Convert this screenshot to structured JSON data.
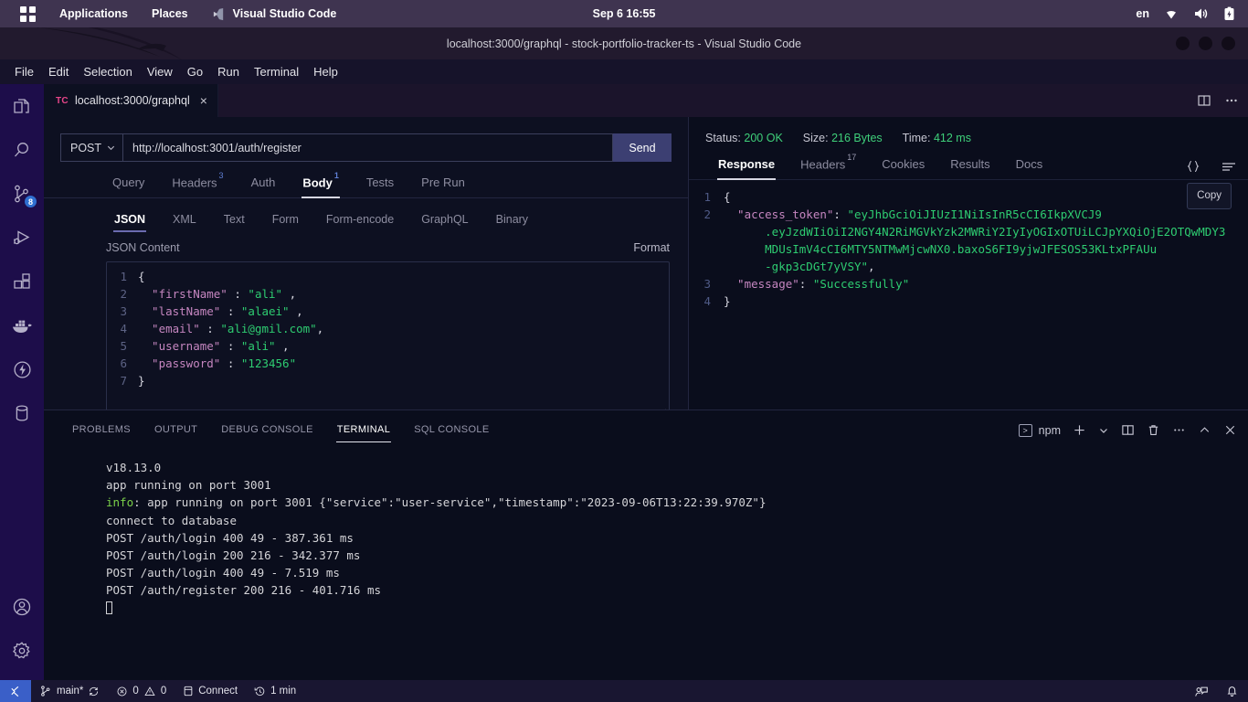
{
  "os_panel": {
    "apps_label": "Applications",
    "places_label": "Places",
    "active_app": "Visual Studio Code",
    "clock": "Sep 6  16:55",
    "language": "en",
    "icons": [
      "wifi-icon",
      "volume-icon",
      "battery-icon"
    ]
  },
  "titlebar": {
    "title": "localhost:3000/graphql - stock-portfolio-tracker-ts - Visual Studio Code",
    "window_controls": [
      "minimize-button",
      "maximize-button",
      "close-button"
    ]
  },
  "menubar": {
    "items": [
      "File",
      "Edit",
      "Selection",
      "View",
      "Go",
      "Run",
      "Terminal",
      "Help"
    ]
  },
  "activitybar": {
    "items": [
      {
        "name": "explorer",
        "icon": "files-icon",
        "badge": ""
      },
      {
        "name": "search",
        "icon": "search-icon",
        "badge": ""
      },
      {
        "name": "source-control",
        "icon": "source-control-icon",
        "badge": "8"
      },
      {
        "name": "run-and-debug",
        "icon": "run-debug-icon",
        "badge": ""
      },
      {
        "name": "extensions",
        "icon": "extensions-icon",
        "badge": ""
      },
      {
        "name": "docker",
        "icon": "docker-whale-icon",
        "badge": ""
      },
      {
        "name": "thunder-client",
        "icon": "thunderbolt-icon",
        "badge": ""
      },
      {
        "name": "database",
        "icon": "database-icon",
        "badge": ""
      }
    ],
    "bottom": [
      {
        "name": "accounts",
        "icon": "account-icon"
      },
      {
        "name": "settings",
        "icon": "gear-icon"
      }
    ]
  },
  "editor": {
    "tab": {
      "badge": "TC",
      "label": "localhost:3000/graphql",
      "close": "×"
    },
    "actions": [
      "split-editor-icon",
      "more-actions-icon"
    ]
  },
  "request": {
    "method": "POST",
    "method_caret": "chevron-down-icon",
    "url": "http://localhost:3001/auth/register",
    "send_label": "Send",
    "tabs": [
      {
        "label": "Query",
        "badge": "",
        "active": false
      },
      {
        "label": "Headers",
        "badge": "3",
        "active": false
      },
      {
        "label": "Auth",
        "badge": "",
        "active": false
      },
      {
        "label": "Body",
        "badge": "1",
        "active": true
      },
      {
        "label": "Tests",
        "badge": "",
        "active": false
      },
      {
        "label": "Pre Run",
        "badge": "",
        "active": false
      }
    ],
    "body_types": [
      {
        "label": "JSON",
        "active": true
      },
      {
        "label": "XML",
        "active": false
      },
      {
        "label": "Text",
        "active": false
      },
      {
        "label": "Form",
        "active": false
      },
      {
        "label": "Form-encode",
        "active": false
      },
      {
        "label": "GraphQL",
        "active": false
      },
      {
        "label": "Binary",
        "active": false
      }
    ],
    "json_content_label": "JSON Content",
    "format_label": "Format",
    "body_lines": [
      {
        "n": "1",
        "segments": [
          {
            "t": "{",
            "c": "k-punc"
          }
        ]
      },
      {
        "n": "2",
        "segments": [
          {
            "t": "  \"firstName\"",
            "c": "k-key"
          },
          {
            "t": " : ",
            "c": "k-colon"
          },
          {
            "t": "\"ali\"",
            "c": "k-str"
          },
          {
            "t": " ,",
            "c": "k-punc"
          }
        ]
      },
      {
        "n": "3",
        "segments": [
          {
            "t": "  \"lastName\"",
            "c": "k-key"
          },
          {
            "t": " : ",
            "c": "k-colon"
          },
          {
            "t": "\"alaei\"",
            "c": "k-str"
          },
          {
            "t": " ,",
            "c": "k-punc"
          }
        ]
      },
      {
        "n": "4",
        "segments": [
          {
            "t": "  \"email\"",
            "c": "k-key"
          },
          {
            "t": " : ",
            "c": "k-colon"
          },
          {
            "t": "\"ali@gmil.com\"",
            "c": "k-str"
          },
          {
            "t": ",",
            "c": "k-punc"
          }
        ]
      },
      {
        "n": "5",
        "segments": [
          {
            "t": "  \"username\"",
            "c": "k-key"
          },
          {
            "t": " : ",
            "c": "k-colon"
          },
          {
            "t": "\"ali\"",
            "c": "k-str"
          },
          {
            "t": " ,",
            "c": "k-punc"
          }
        ]
      },
      {
        "n": "6",
        "segments": [
          {
            "t": "  \"password\"",
            "c": "k-key"
          },
          {
            "t": " : ",
            "c": "k-colon"
          },
          {
            "t": "\"123456\"",
            "c": "k-str"
          }
        ]
      },
      {
        "n": "7",
        "segments": [
          {
            "t": "}",
            "c": "k-punc"
          }
        ]
      }
    ]
  },
  "response": {
    "status_label": "Status:",
    "status_value": "200 OK",
    "size_label": "Size:",
    "size_value": "216 Bytes",
    "time_label": "Time:",
    "time_value": "412 ms",
    "tabs": [
      {
        "label": "Response",
        "badge": "",
        "active": true
      },
      {
        "label": "Headers",
        "badge": "17",
        "active": false
      },
      {
        "label": "Cookies",
        "badge": "",
        "active": false
      },
      {
        "label": "Results",
        "badge": "",
        "active": false
      },
      {
        "label": "Docs",
        "badge": "",
        "active": false
      }
    ],
    "actions": [
      "format-json-icon",
      "response-menu-icon"
    ],
    "copy_label": "Copy",
    "lines": [
      {
        "n": "1",
        "segments": [
          {
            "t": "{",
            "c": "r-punc"
          }
        ]
      },
      {
        "n": "2",
        "segments": [
          {
            "t": "  \"access_token\"",
            "c": "r-key"
          },
          {
            "t": ": ",
            "c": "r-punc"
          },
          {
            "t": "\"eyJhbGciOiJIUzI1NiIsInR5cCI6IkpXVCJ9",
            "c": "r-str"
          }
        ]
      },
      {
        "n": "",
        "segments": [
          {
            "t": "      .eyJzdWIiOiI2NGY4N2RiMGVkYzk2MWRiY2IyIyOGIxOTUiLCJpYXQiOjE2OTQwMDY3",
            "c": "r-str"
          }
        ]
      },
      {
        "n": "",
        "segments": [
          {
            "t": "      MDUsImV4cCI6MTY5NTMwMjcwNX0.baxoS6FI9yjwJFESOS53KLtxPFAUu",
            "c": "r-str"
          }
        ]
      },
      {
        "n": "",
        "segments": [
          {
            "t": "      -gkp3cDGt7yVSY\"",
            "c": "r-str"
          },
          {
            "t": ",",
            "c": "r-punc"
          }
        ]
      },
      {
        "n": "3",
        "segments": [
          {
            "t": "  \"message\"",
            "c": "r-key"
          },
          {
            "t": ": ",
            "c": "r-punc"
          },
          {
            "t": "\"Successfully\"",
            "c": "r-str"
          }
        ]
      },
      {
        "n": "4",
        "segments": [
          {
            "t": "}",
            "c": "r-punc"
          }
        ]
      }
    ]
  },
  "panel": {
    "tabs": [
      {
        "label": "PROBLEMS",
        "active": false
      },
      {
        "label": "OUTPUT",
        "active": false
      },
      {
        "label": "DEBUG CONSOLE",
        "active": false
      },
      {
        "label": "TERMINAL",
        "active": true
      },
      {
        "label": "SQL CONSOLE",
        "active": false
      }
    ],
    "terminal_name": "npm",
    "actions": [
      "new-terminal-icon",
      "terminal-profile-chevron-icon",
      "split-terminal-icon",
      "kill-terminal-icon",
      "panel-more-icon",
      "maximize-panel-icon",
      "close-panel-icon"
    ],
    "terminal_lines": [
      {
        "text": "v18.13.0",
        "type": "plain"
      },
      {
        "text": "app running on port 3001",
        "type": "plain"
      },
      {
        "prefix": "info",
        "text": ": app running on port 3001 {\"service\":\"user-service\",\"timestamp\":\"2023-09-06T13:22:39.970Z\"}",
        "type": "info"
      },
      {
        "text": "connect to database",
        "type": "plain"
      },
      {
        "text": "POST /auth/login 400 49 - 387.361 ms",
        "type": "plain"
      },
      {
        "text": "POST /auth/login 200 216 - 342.377 ms",
        "type": "plain"
      },
      {
        "text": "POST /auth/login 400 49 - 7.519 ms",
        "type": "plain"
      },
      {
        "text": "POST /auth/register 200 216 - 401.716 ms",
        "type": "plain"
      }
    ]
  },
  "statusbar": {
    "remote_icon": "remote-window-icon",
    "branch": "main*",
    "sync_icon": "sync-icon",
    "errors": "0",
    "warnings": "0",
    "db_label": "Connect",
    "timer": "1 min",
    "right_icons": [
      "feedback-icon",
      "bell-icon"
    ]
  }
}
